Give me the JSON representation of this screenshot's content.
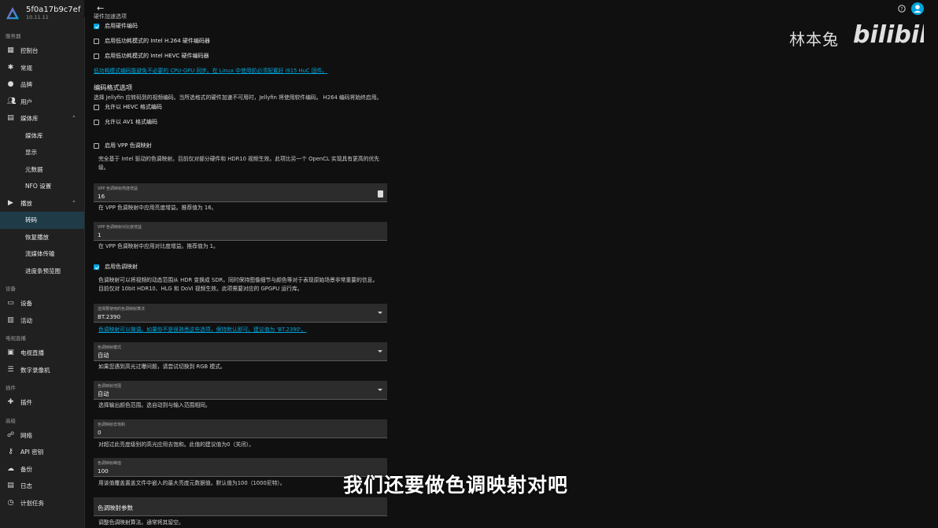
{
  "app": {
    "server_name": "5f0a17b9c7ef",
    "version": "10.11.11"
  },
  "sidebar": {
    "sections": {
      "server": "服务器",
      "devices": "设备",
      "livetv": "电视直播",
      "plugins": "插件",
      "advanced": "高级"
    },
    "items": {
      "dashboard": "控制台",
      "general": "常规",
      "branding": "品牌",
      "users": "用户",
      "libraries": "媒体库",
      "libraries_sub": "媒体库",
      "display": "显示",
      "metadata": "元数据",
      "nfo": "NFO 设置",
      "playback": "播放",
      "transcoding": "转码",
      "resume": "恢复播放",
      "streaming": "流媒体传输",
      "trickplay": "进度条预览图",
      "devices": "设备",
      "activity": "活动",
      "livetv": "电视直播",
      "dvr": "数字录像机",
      "plugins": "插件",
      "networking": "网络",
      "apikeys": "API 密钥",
      "backups": "备份",
      "logs": "日志",
      "tasks": "计划任务"
    }
  },
  "content": {
    "cut_heading": "硬件加速选项",
    "hw_encoding": "启用硬件编码",
    "lowpower_h264": "启用低功耗模式的 Intel H.264 硬件编码器",
    "lowpower_hevc": "启用低功耗模式的 Intel HEVC 硬件编码器",
    "lowpower_link": "低功耗模式编码能避免不必要的 CPU-GPU 同步。在 Linux 中使用前必须配置好 i915 HuC 固件。",
    "encoding_format_heading": "编码格式选项",
    "encoding_format_desc": "选择 Jellyfin 应转码到的视频编码。当所选格式的硬件加速不可用时，Jellyfin 将使用软件编码。 H264 编码将始终启用。",
    "allow_hevc": "允许以 HEVC 格式编码",
    "allow_av1": "允许以 AV1 格式编码",
    "vpp_tonemap": "启用 VPP 色调映射",
    "vpp_tonemap_desc_1": "完全基于 Intel 驱动的色调映射。目前仅对部分硬件和 HDR10 视频生效。此项比另一个 OpenCL 实现具有更高的优先",
    "vpp_tonemap_desc_2": "级。",
    "vpp_brightness_label": "VPP 色调映射亮度增益",
    "vpp_brightness_value": "16",
    "vpp_brightness_hint": "在 VPP 色调映射中应用亮度增益。推荐值为 16。",
    "vpp_contrast_label": "VPP 色调映射对比度增益",
    "vpp_contrast_value": "1",
    "vpp_contrast_hint": "在 VPP 色调映射中应用对比度增益。推荐值为 1。",
    "tonemap": "启用色调映射",
    "tonemap_desc_1": "色调映射可以将视频的动态范围从 HDR 变换成 SDR，同时保持图像细节与颜色等对于表现原始场景非常重要的信息。",
    "tonemap_desc_2": "目前仅对 10bit HDR10、HLG 和 DoVi 视频生效。此项需要对应的 GPGPU 运行库。",
    "algo_label": "选择要使用的色调映射算法",
    "algo_value": "BT.2390",
    "algo_link": "色调映射可以微调。如果你不是很熟悉这些选项，保持默认即可。建议值为 'BT.2390'。",
    "mode_label": "色调映射模式",
    "mode_value": "自动",
    "mode_hint": "如果您遇到高光过曝问题，请尝试切换到 RGB 模式。",
    "range_label": "色调映射范围",
    "range_value": "自动",
    "range_hint": "选择输出颜色范围。选自动到与输入范围相同。",
    "desat_label": "色调映射去饱和",
    "desat_value": "0",
    "desat_hint": "对超过此亮度级别的高光应用去饱和。此值的建议值为0（关闭）。",
    "peak_label": "色调映射峰值",
    "peak_value": "100",
    "peak_hint": "用该值覆盖置盖文件中嵌入的最大亮度元数据值。默认值为100（1000尼特）。",
    "param_label": "色调映射参数",
    "param_hint": "调整色调映射算法。通常将其留空。"
  },
  "overlay": {
    "watermark": "林本兔",
    "watermark_logo": "bilibili",
    "subtitle": "我们还要做色调映射对吧"
  },
  "colors": {
    "accent": "#00a4dc",
    "sidebar_bg": "#202020",
    "page_bg": "#101010"
  }
}
